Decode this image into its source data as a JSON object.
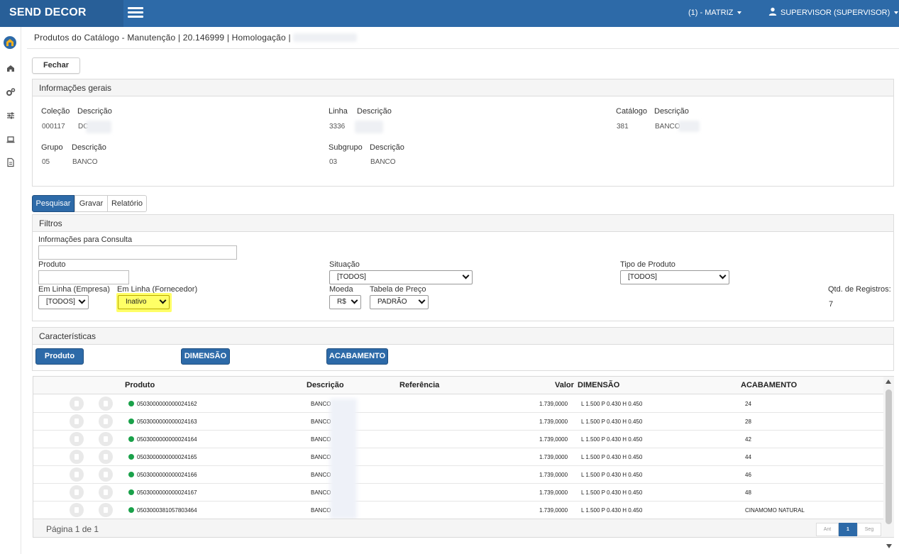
{
  "app": {
    "brand": "SEND DECOR",
    "company": "(1) - MATRIZ",
    "user": "SUPERVISOR (SUPERVISOR)"
  },
  "breadcrumb": "Produtos do Catálogo - Manutenção | 20.146999 | Homologação |",
  "actions": {
    "close": "Fechar"
  },
  "info": {
    "title": "Informações gerais",
    "colecao_label": "Coleção",
    "colecao_desc_label": "Descrição",
    "colecao_value": "000117",
    "colecao_desc": "DC",
    "linha_label": "Linha",
    "linha_desc_label": "Descrição",
    "linha_value": "3336",
    "catalogo_label": "Catálogo",
    "catalogo_desc_label": "Descrição",
    "catalogo_value": "381",
    "catalogo_desc": "BANCO",
    "grupo_label": "Grupo",
    "grupo_desc_label": "Descrição",
    "grupo_value": "05",
    "grupo_desc": "BANCO",
    "subgrupo_label": "Subgrupo",
    "subgrupo_desc_label": "Descrição",
    "subgrupo_value": "03",
    "subgrupo_desc": "BANCO"
  },
  "tabs": [
    "Pesquisar",
    "Gravar",
    "Relatório"
  ],
  "filters": {
    "title": "Filtros",
    "consulta_label": "Informações para Consulta",
    "produto_label": "Produto",
    "situacao_label": "Situação",
    "situacao_value": "[TODOS]",
    "tipo_label": "Tipo de Produto",
    "tipo_value": "[TODOS]",
    "em_linha_empresa_label": "Em Linha (Empresa)",
    "em_linha_empresa_value": "[TODOS]",
    "em_linha_fornecedor_label": "Em Linha (Fornecedor)",
    "em_linha_fornecedor_value": "Inativo",
    "moeda_label": "Moeda",
    "moeda_value": "R$",
    "tabela_label": "Tabela de Preço",
    "tabela_value": "PADRÃO",
    "qtd_label": "Qtd. de Registros:",
    "qtd_value": "7"
  },
  "caracteristicas": {
    "title": "Características",
    "buttons": [
      "Produto",
      "DIMENSÃO",
      "ACABAMENTO"
    ]
  },
  "grid": {
    "headers": {
      "produto": "Produto",
      "descricao": "Descrição",
      "referencia": "Referência",
      "valor": "Valor",
      "dimensao": "DIMENSÃO",
      "acabamento": "ACABAMENTO"
    },
    "rows": [
      {
        "produto": "0503000000000024162",
        "descricao": "BANCO",
        "valor": "1.739,0000",
        "dimensao": "L 1.500 P 0.430 H 0.450",
        "acabamento": "24"
      },
      {
        "produto": "0503000000000024163",
        "descricao": "BANCO",
        "valor": "1.739,0000",
        "dimensao": "L 1.500 P 0.430 H 0.450",
        "acabamento": "28"
      },
      {
        "produto": "0503000000000024164",
        "descricao": "BANCO",
        "valor": "1.739,0000",
        "dimensao": "L 1.500 P 0.430 H 0.450",
        "acabamento": "42"
      },
      {
        "produto": "0503000000000024165",
        "descricao": "BANCO",
        "valor": "1.739,0000",
        "dimensao": "L 1.500 P 0.430 H 0.450",
        "acabamento": "44"
      },
      {
        "produto": "0503000000000024166",
        "descricao": "BANCO",
        "valor": "1.739,0000",
        "dimensao": "L 1.500 P 0.430 H 0.450",
        "acabamento": "46"
      },
      {
        "produto": "0503000000000024167",
        "descricao": "BANCO",
        "valor": "1.739,0000",
        "dimensao": "L 1.500 P 0.430 H 0.450",
        "acabamento": "48"
      },
      {
        "produto": "0503000381057803464",
        "descricao": "BANCO",
        "valor": "1.739,0000",
        "dimensao": "L 1.500 P 0.430 H 0.450",
        "acabamento": "CINAMOMO NATURAL"
      }
    ],
    "pager": {
      "info": "Página 1 de 1",
      "prev": "Ant",
      "current": "1",
      "next": "Seg"
    }
  },
  "colors": {
    "primary": "#2d6aa8",
    "brand_bg": "#285f98",
    "highlight": "#ffff66",
    "status_active": "#1aa14a"
  }
}
